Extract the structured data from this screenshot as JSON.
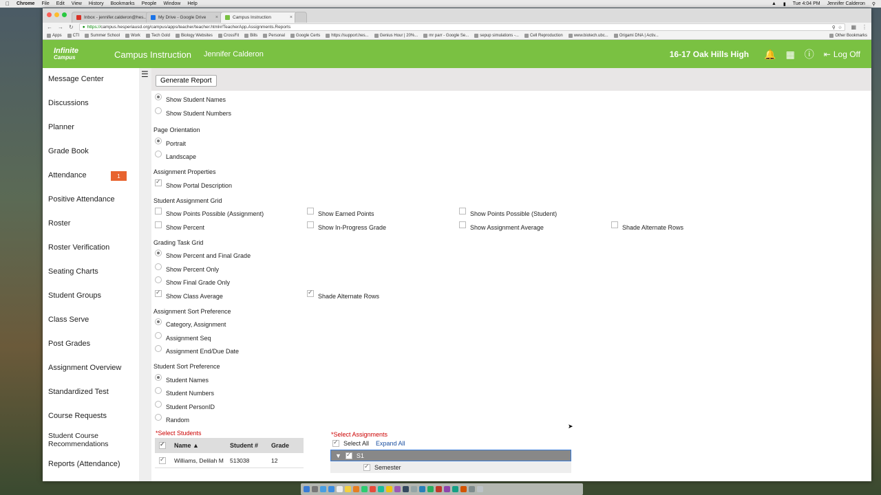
{
  "menubar": {
    "app": "Chrome",
    "menus": [
      "File",
      "Edit",
      "View",
      "History",
      "Bookmarks",
      "People",
      "Window",
      "Help"
    ],
    "clock": "Tue 4:04 PM",
    "user": "Jennifer Calderon"
  },
  "tabs": [
    {
      "label": "Inbox - jennifer.calderon@hes...",
      "color": "#d93025"
    },
    {
      "label": "My Drive - Google Drive",
      "color": "#1a73e8"
    },
    {
      "label": "Campus Instruction",
      "color": "#7ac142"
    }
  ],
  "address": {
    "https": "https://",
    "rest": "campus.hesperiausd.org/campus/apps/teacher/teacher.html#/TeacherApp.Assignments.Reports"
  },
  "bookmarks": [
    "Apps",
    "CTI",
    "Summer School",
    "Work",
    "Tech Gold",
    "Biology Websites",
    "CrossFit",
    "Bills",
    "Personal",
    "Google Certs",
    "https://support.hes...",
    "Genius Hour | 20%...",
    "mr parr - Google Se...",
    "sepup simulations -...",
    "Cell Reproduction",
    "www.biotech.ubc...",
    "Origami DNA | Activ..."
  ],
  "bookmarks_other": "Other Bookmarks",
  "header": {
    "logo_top": "Infinite",
    "logo_bottom": "Campus",
    "app_title": "Campus Instruction",
    "user": "Jennifer Calderon",
    "school": "16-17 Oak Hills High",
    "logoff": "Log Off"
  },
  "sidebar": [
    "Message Center",
    "Discussions",
    "Planner",
    "Grade Book",
    "Attendance",
    "Positive Attendance",
    "Roster",
    "Roster Verification",
    "Seating Charts",
    "Student Groups",
    "Class Serve",
    "Post Grades",
    "Assignment Overview",
    "Standardized Test",
    "Course Requests",
    "Student Course Recommendations",
    "Reports (Attendance)"
  ],
  "attendance_badge": "1",
  "generate_report": "Generate Report",
  "options": {
    "show_names": "Show Student Names",
    "show_numbers": "Show Student Numbers",
    "orientation_title": "Page Orientation",
    "portrait": "Portrait",
    "landscape": "Landscape",
    "assign_props_title": "Assignment Properties",
    "portal_desc": "Show Portal Description",
    "grid_title": "Student Assignment Grid",
    "pp_assignment": "Show Points Possible (Assignment)",
    "earned_points": "Show Earned Points",
    "pp_student": "Show Points Possible (Student)",
    "show_percent": "Show Percent",
    "in_progress": "Show In-Progress Grade",
    "assign_avg": "Show Assignment Average",
    "shade_rows_1": "Shade Alternate Rows",
    "task_title": "Grading Task Grid",
    "pct_final": "Show Percent and Final Grade",
    "pct_only": "Show Percent Only",
    "final_only": "Show Final Grade Only",
    "class_avg": "Show Class Average",
    "shade_rows_2": "Shade Alternate Rows",
    "assign_sort_title": "Assignment Sort Preference",
    "cat_assign": "Category, Assignment",
    "assign_seq": "Assignment Seq",
    "end_due": "Assignment End/Due Date",
    "stu_sort_title": "Student Sort Preference",
    "stu_names": "Student Names",
    "stu_numbers": "Student Numbers",
    "stu_personid": "Student PersonID",
    "random": "Random"
  },
  "select_students": {
    "label": "*Select Students",
    "columns": [
      "Name",
      "Student #",
      "Grade"
    ],
    "rows": [
      [
        "Williams, Delilah M",
        "513038",
        "12"
      ]
    ]
  },
  "select_assignments": {
    "label": "*Select Assignments",
    "select_all": "Select All",
    "expand_all": "Expand All",
    "s1": "S1",
    "semester": "Semester"
  }
}
